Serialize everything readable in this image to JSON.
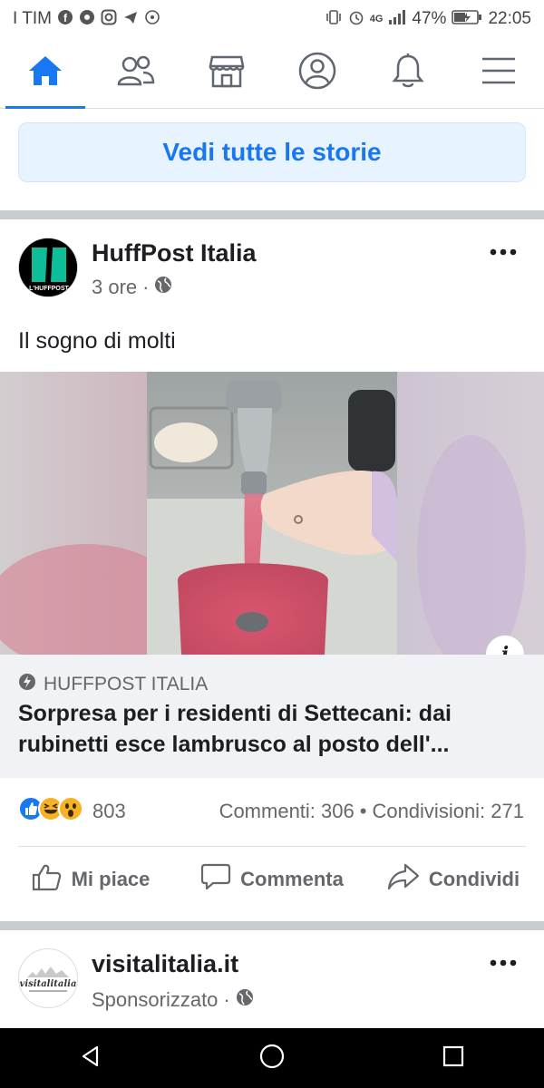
{
  "status_bar": {
    "carrier": "I TIM",
    "network": "4G",
    "battery": "47%",
    "time": "22:05"
  },
  "nav": {
    "tabs": [
      {
        "icon": "home-icon",
        "active": true
      },
      {
        "icon": "friends-icon",
        "active": false
      },
      {
        "icon": "marketplace-icon",
        "active": false
      },
      {
        "icon": "profile-icon",
        "active": false
      },
      {
        "icon": "bell-icon",
        "active": false
      },
      {
        "icon": "menu-icon",
        "active": false
      }
    ]
  },
  "stories": {
    "button_label": "Vedi tutte le storie"
  },
  "post": {
    "author": "HuffPost Italia",
    "avatar_text": "L'HUFFPOST",
    "time": "3 ore",
    "visibility_icon": "globe-icon",
    "text": "Il sogno di molti",
    "link": {
      "source": "HUFFPOST ITALIA",
      "title": "Sorpresa per i residenti di Settecani: dai rubinetti  esce lambrusco al posto dell'..."
    },
    "reactions": {
      "icons": [
        "like-icon",
        "haha-icon",
        "wow-icon"
      ],
      "count": "803"
    },
    "stats": {
      "comments": "Commenti: 306",
      "separator": "•",
      "shares": "Condivisioni: 271"
    },
    "actions": {
      "like": "Mi piace",
      "comment": "Commenta",
      "share": "Condividi"
    },
    "info_label": "i"
  },
  "sponsored_post": {
    "author": "visitalitalia.it",
    "avatar_text": "visitalitalia",
    "meta": "Sponsorizzato"
  },
  "colors": {
    "accent": "#1877f2",
    "secondary_text": "#65676b",
    "separator": "#c9ccd1",
    "link_bg": "#f0f2f5"
  }
}
